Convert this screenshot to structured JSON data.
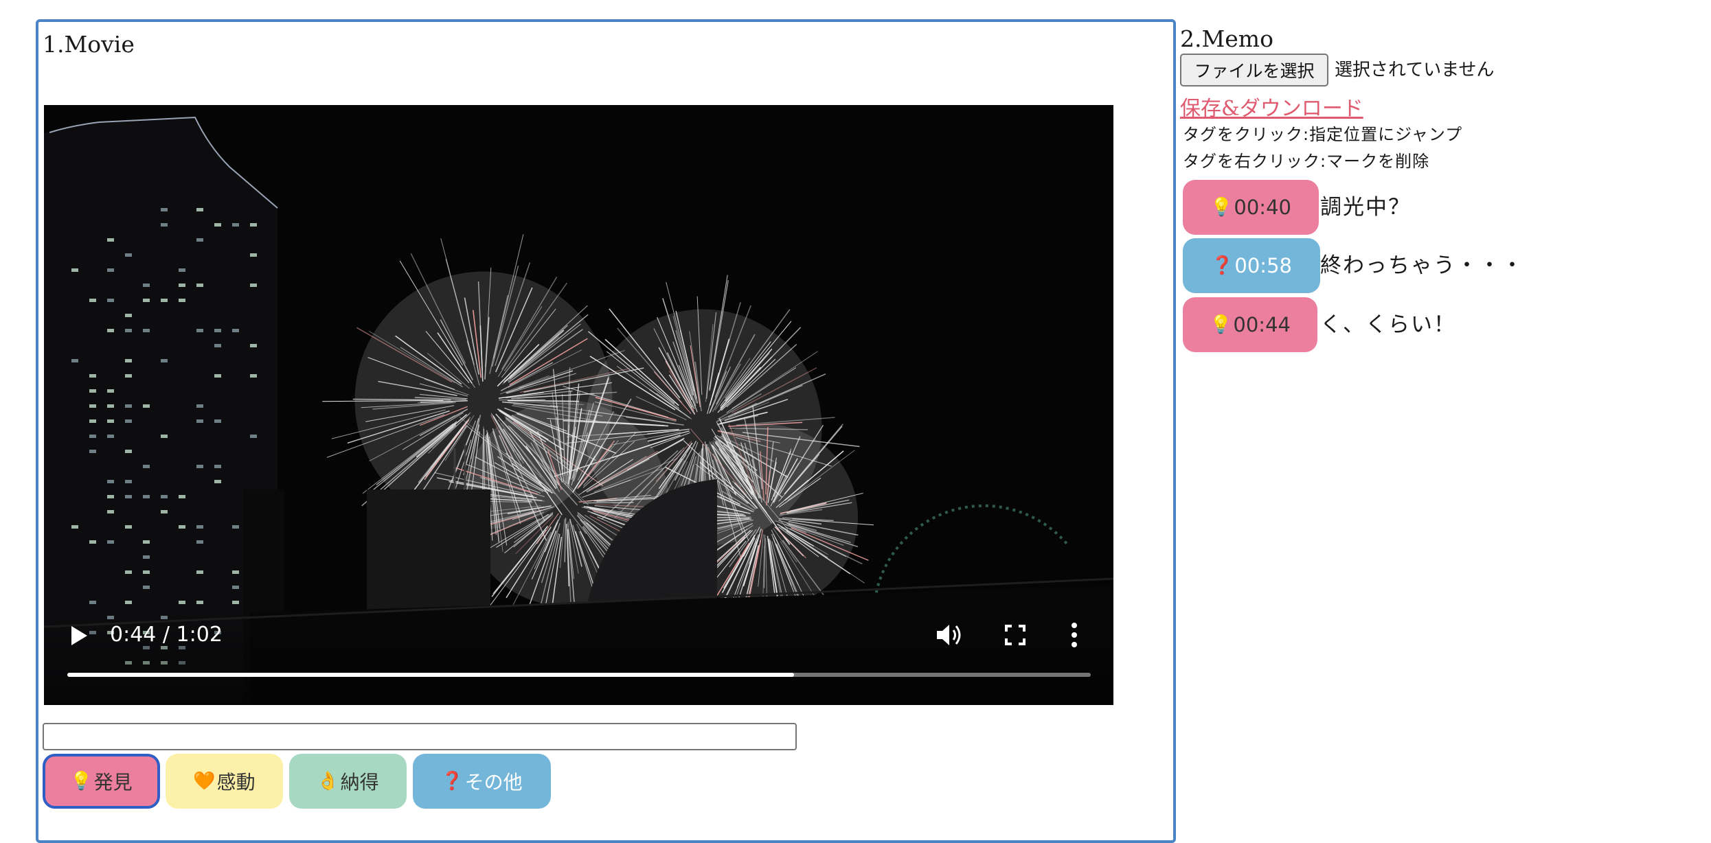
{
  "movie": {
    "title": "1.Movie",
    "player": {
      "time_display": "0:44 / 1:02",
      "progress_fraction": 0.71
    },
    "memo_input": {
      "value": "",
      "placeholder": ""
    },
    "tag_buttons": [
      {
        "icon": "lightbulb-icon",
        "glyph": "💡",
        "label": "発見",
        "color": "#ec7f9e",
        "selected": true
      },
      {
        "icon": "orange-heart-icon",
        "glyph": "🧡",
        "label": "感動",
        "color": "#fdf0a8"
      },
      {
        "icon": "ok-hand-icon",
        "glyph": "👌",
        "label": "納得",
        "color": "#a7d9c2"
      },
      {
        "icon": "question-mark-icon",
        "glyph": "❓",
        "label": "その他",
        "color": "#73b6d9"
      }
    ]
  },
  "memo": {
    "title": "2.Memo",
    "file_button": "ファイルを選択",
    "file_status": "選択されていません",
    "download_link": "保存&ダウンロード",
    "help_lines": [
      "タグをクリック:指定位置にジャンプ",
      "タグを右クリック:マークを削除"
    ],
    "marks": [
      {
        "icon": "lightbulb-icon",
        "glyph": "💡",
        "time": "00:40",
        "note": "調光中？",
        "color": "#ec7f9e"
      },
      {
        "icon": "question-mark-icon",
        "glyph": "❓",
        "time": "00:58",
        "note": "終わっちゃう・・・",
        "color": "#73b6d9"
      },
      {
        "icon": "lightbulb-icon",
        "glyph": "💡",
        "time": "00:44",
        "note": "く、くらい！",
        "color": "#ec7f9e"
      }
    ]
  }
}
